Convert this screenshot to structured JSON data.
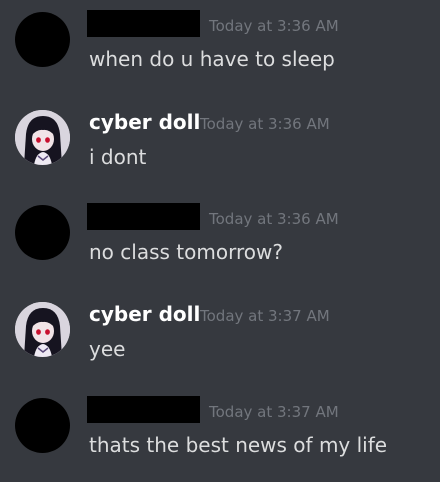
{
  "messages": [
    {
      "author": "",
      "redacted": true,
      "avatar_icon": "redacted-avatar",
      "timestamp": "Today at 3:36 AM",
      "text": "when do u have to sleep"
    },
    {
      "author": "cyber doll",
      "redacted": false,
      "avatar_icon": "anime-girl-avatar",
      "timestamp": "Today at 3:36 AM",
      "text": "i dont"
    },
    {
      "author": "",
      "redacted": true,
      "avatar_icon": "redacted-avatar",
      "timestamp": "Today at 3:36 AM",
      "text": "no class tomorrow?"
    },
    {
      "author": "cyber doll",
      "redacted": false,
      "avatar_icon": "anime-girl-avatar",
      "timestamp": "Today at 3:37 AM",
      "text": "yee"
    },
    {
      "author": "",
      "redacted": true,
      "avatar_icon": "redacted-avatar",
      "timestamp": "Today at 3:37 AM",
      "text": "thats the best news of my life"
    }
  ],
  "colors": {
    "background": "#36393f",
    "username": "#ffffff",
    "timestamp": "#72767d",
    "message_text": "#dcddde",
    "redaction": "#000000"
  }
}
